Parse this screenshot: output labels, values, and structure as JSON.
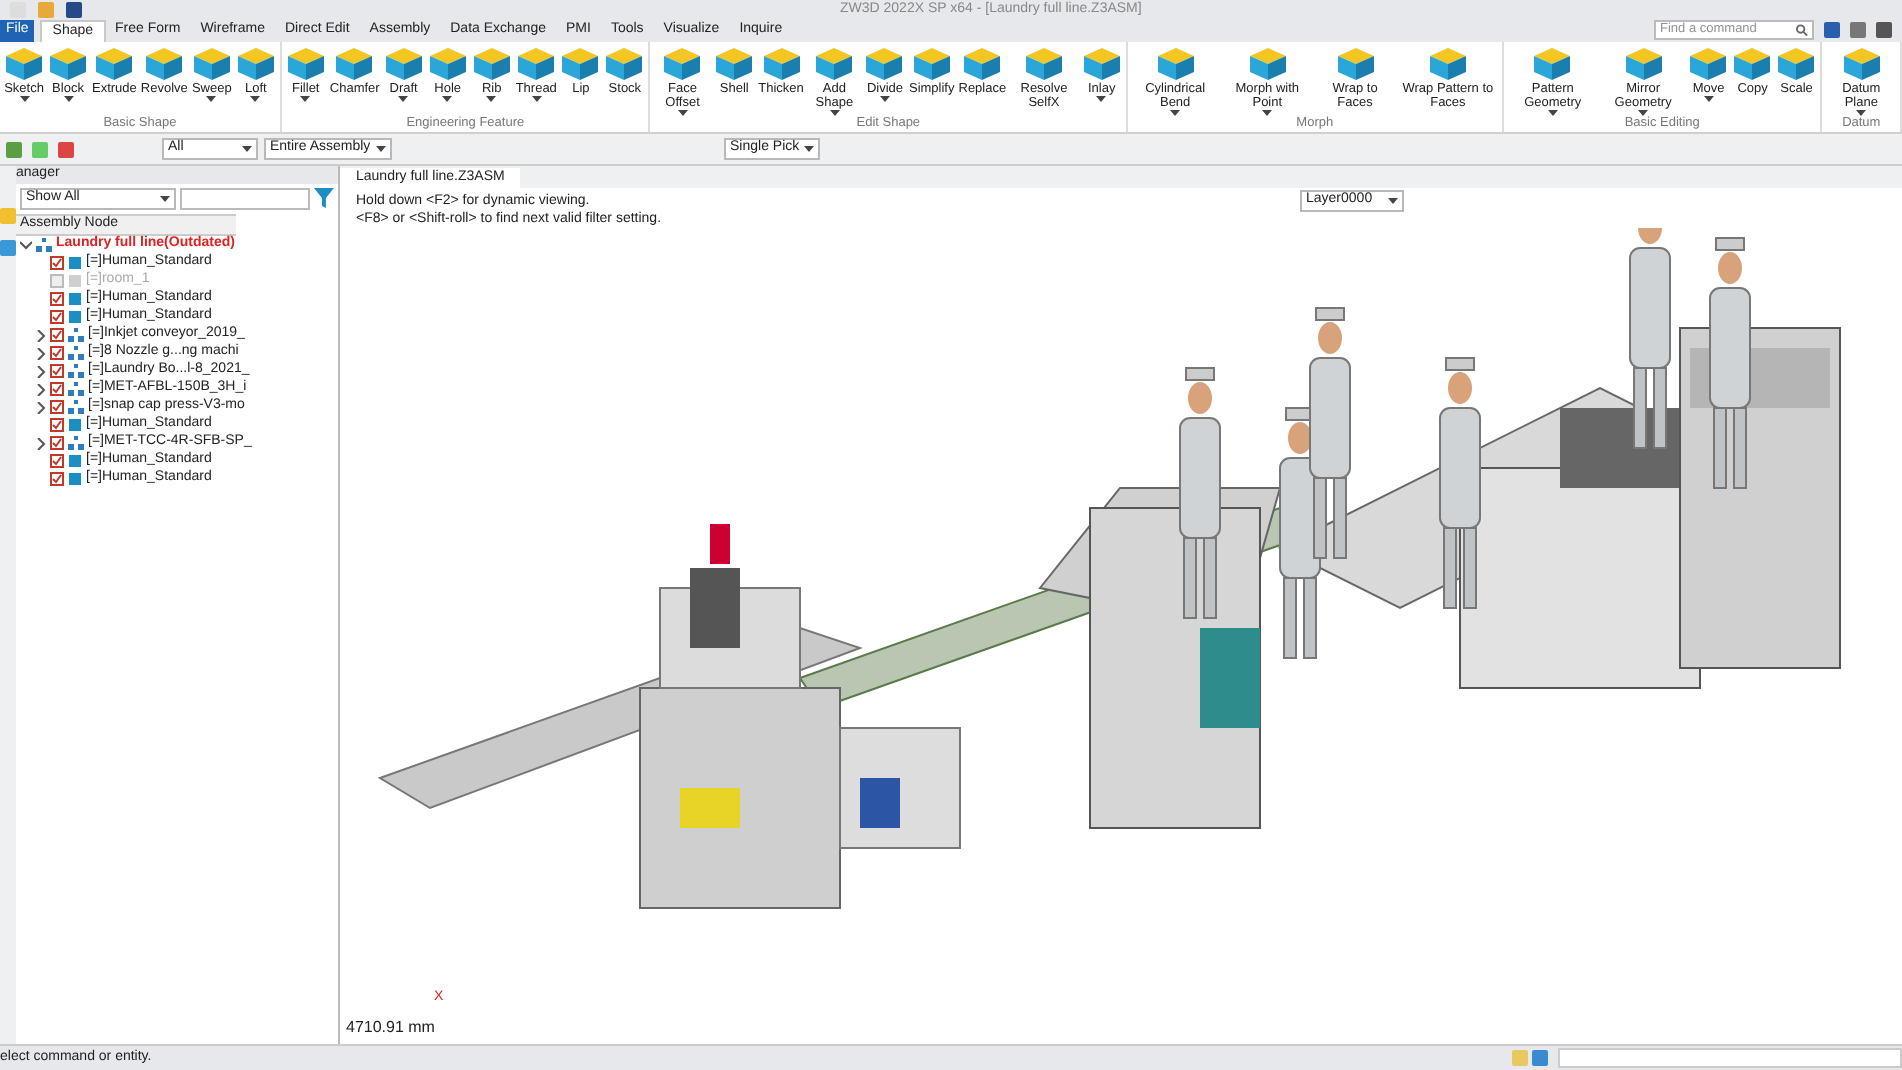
{
  "window": {
    "title": "ZW3D 2022X SP x64 - [Laundry full line.Z3ASM]"
  },
  "menu_tabs": [
    {
      "label": "File",
      "kind": "file",
      "selected": false
    },
    {
      "label": "Shape",
      "kind": "tab",
      "selected": true
    },
    {
      "label": "Free Form",
      "kind": "tab",
      "selected": false
    },
    {
      "label": "Wireframe",
      "kind": "tab",
      "selected": false
    },
    {
      "label": "Direct Edit",
      "kind": "tab",
      "selected": false
    },
    {
      "label": "Assembly",
      "kind": "tab",
      "selected": false
    },
    {
      "label": "Data Exchange",
      "kind": "tab",
      "selected": false
    },
    {
      "label": "PMI",
      "kind": "tab",
      "selected": false
    },
    {
      "label": "Tools",
      "kind": "tab",
      "selected": false
    },
    {
      "label": "Visualize",
      "kind": "tab",
      "selected": false
    },
    {
      "label": "Inquire",
      "kind": "tab",
      "selected": false
    }
  ],
  "command_search": {
    "placeholder": "Find a command"
  },
  "ribbon_groups": [
    {
      "label": "Basic Shape",
      "tools": [
        {
          "label": "Sketch",
          "dropdown": true
        },
        {
          "label": "Block",
          "dropdown": true
        },
        {
          "label": "Extrude",
          "dropdown": false
        },
        {
          "label": "Revolve",
          "dropdown": false
        },
        {
          "label": "Sweep",
          "dropdown": true
        },
        {
          "label": "Loft",
          "dropdown": true
        }
      ]
    },
    {
      "label": "Engineering Feature",
      "tools": [
        {
          "label": "Fillet",
          "dropdown": true
        },
        {
          "label": "Chamfer",
          "dropdown": false
        },
        {
          "label": "Draft",
          "dropdown": true
        },
        {
          "label": "Hole",
          "dropdown": true
        },
        {
          "label": "Rib",
          "dropdown": true
        },
        {
          "label": "Thread",
          "dropdown": true
        },
        {
          "label": "Lip",
          "dropdown": false
        },
        {
          "label": "Stock",
          "dropdown": false
        }
      ]
    },
    {
      "label": "Edit Shape",
      "tools": [
        {
          "label": "Face Offset",
          "dropdown": true
        },
        {
          "label": "Shell",
          "dropdown": false
        },
        {
          "label": "Thicken",
          "dropdown": false
        },
        {
          "label": "Add Shape",
          "dropdown": true
        },
        {
          "label": "Divide",
          "dropdown": true
        },
        {
          "label": "Simplify",
          "dropdown": false
        },
        {
          "label": "Replace",
          "dropdown": false
        },
        {
          "label": "Resolve SelfX",
          "dropdown": false
        },
        {
          "label": "Inlay",
          "dropdown": true
        }
      ]
    },
    {
      "label": "Morph",
      "tools": [
        {
          "label": "Cylindrical Bend",
          "dropdown": true
        },
        {
          "label": "Morph with Point",
          "dropdown": true
        },
        {
          "label": "Wrap to Faces",
          "dropdown": false
        },
        {
          "label": "Wrap Pattern to Faces",
          "dropdown": false
        }
      ]
    },
    {
      "label": "Basic Editing",
      "tools": [
        {
          "label": "Pattern Geometry",
          "dropdown": true
        },
        {
          "label": "Mirror Geometry",
          "dropdown": true
        },
        {
          "label": "Move",
          "dropdown": true
        },
        {
          "label": "Copy",
          "dropdown": false
        },
        {
          "label": "Scale",
          "dropdown": false
        }
      ]
    },
    {
      "label": "Datum",
      "tools": [
        {
          "label": "Datum Plane",
          "dropdown": true
        }
      ]
    }
  ],
  "toolbar": {
    "filter": "All",
    "scope": "Entire Assembly",
    "pick_mode": "Single Pick"
  },
  "manager": {
    "title": "anager",
    "show": "Show All",
    "column": "Assembly Node",
    "root": {
      "label": "Laundry full line(Outdated)",
      "expanded": true,
      "children": [
        {
          "label": "[=]Human_Standard",
          "kind": "part",
          "checked": true,
          "expandable": false
        },
        {
          "label": "[=]room_1",
          "kind": "part",
          "checked": false,
          "expandable": false
        },
        {
          "label": "[=]Human_Standard",
          "kind": "part",
          "checked": true,
          "expandable": false
        },
        {
          "label": "[=]Human_Standard",
          "kind": "part",
          "checked": true,
          "expandable": false
        },
        {
          "label": "[=]Inkjet conveyor_2019_",
          "kind": "assembly",
          "checked": true,
          "expandable": true
        },
        {
          "label": "[=]8 Nozzle g...ng machi",
          "kind": "assembly",
          "checked": true,
          "expandable": true
        },
        {
          "label": "[=]Laundry Bo...l-8_2021_",
          "kind": "assembly",
          "checked": true,
          "expandable": true
        },
        {
          "label": "[=]MET-AFBL-150B_3H_i",
          "kind": "assembly",
          "checked": true,
          "expandable": true
        },
        {
          "label": "[=]snap cap press-V3-mo",
          "kind": "assembly",
          "checked": true,
          "expandable": true
        },
        {
          "label": "[=]Human_Standard",
          "kind": "part",
          "checked": true,
          "expandable": false
        },
        {
          "label": "[=]MET-TCC-4R-SFB-SP_",
          "kind": "assembly",
          "checked": true,
          "expandable": true
        },
        {
          "label": "[=]Human_Standard",
          "kind": "part",
          "checked": true,
          "expandable": false
        },
        {
          "label": "[=]Human_Standard",
          "kind": "part",
          "checked": true,
          "expandable": false
        }
      ]
    }
  },
  "document_tabs": [
    {
      "label": "Laundry full line.Z3ASM",
      "selected": true
    }
  ],
  "viewport": {
    "hints": [
      "Hold down <F2> for dynamic viewing.",
      "<F8> or <Shift-roll> to find next valid filter setting."
    ],
    "layer": "Layer0000",
    "axis_label": "X",
    "measurement": "4710.91 mm"
  },
  "status_bar": {
    "message": "elect command or entity."
  }
}
